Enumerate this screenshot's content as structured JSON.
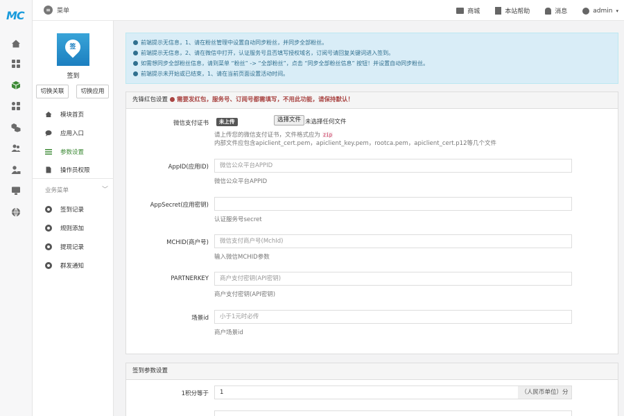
{
  "app": {
    "logo_text": "MC"
  },
  "rail": {
    "icons": [
      "home-icon",
      "grid-icon",
      "cube-icon",
      "apps-icon",
      "cubes-icon",
      "users-icon",
      "user-lock-icon",
      "monitor-icon",
      "globe-icon"
    ],
    "active": "cube-icon",
    "accent": "#3d8a36"
  },
  "topbar": {
    "menu_label": "菜单",
    "shop_label": "商城",
    "help_label": "本站帮助",
    "messages_label": "消息",
    "user_label": "admin"
  },
  "module": {
    "name": "签到",
    "logo_glyph": "签",
    "switch_relation_label": "切换关联",
    "switch_app_label": "切换应用",
    "nav": [
      {
        "label": "模块首页"
      },
      {
        "label": "应用入口"
      },
      {
        "label": "参数设置"
      },
      {
        "label": "操作员权限"
      }
    ],
    "group_title": "业务菜单",
    "group_items": [
      {
        "label": "签到记录"
      },
      {
        "label": "规则添加"
      },
      {
        "label": "提现记录"
      },
      {
        "label": "群发通知"
      }
    ]
  },
  "alert": {
    "lines": [
      "前端提示无信息，1、请在粉丝管理中设置自动同步粉丝，并同步全部粉丝。",
      "前端提示无信息，2、请在微信中打开，认证服务号且否填写授权域名，订阅号请回复关键词进入签到。",
      "如需想同步全部粉丝信息，请到菜单 “粉丝” -> “全部粉丝”，点击 “同步全部粉丝信息” 按钮！并设置自动同步粉丝。",
      "前端提示未开始或已结束，1、请在当前页面设置活动时间。"
    ]
  },
  "redpack_panel": {
    "title": "先锋红包设置",
    "warning": "需要发红包，服务号、订阅号都需填写，不用此功能，请保持默认！",
    "cert": {
      "label": "微信支付证书",
      "badge": "未上传",
      "button": "选择文件",
      "file_status": "未选择任何文件",
      "help_prefix": "请上传您的微信支付证书，文件格式应为",
      "help_code": "zip",
      "help_line2": "内部文件应包含apiclient_cert.pem，apiclient_key.pem，rootca.pem，apiclient_cert.p12等几个文件"
    },
    "fields": [
      {
        "label": "AppID(应用ID)",
        "placeholder": "微信公众平台APPID",
        "value": "",
        "help": "微信公众平台APPID"
      },
      {
        "label": "AppSecret(应用密钥)",
        "placeholder": "",
        "value": "",
        "help": "认证服务号secret"
      },
      {
        "label": "MCHID(商户号)",
        "placeholder": "微信支付商户号(MchId)",
        "value": "",
        "help": "输入微信MCHID参数"
      },
      {
        "label": "PARTNERKEY",
        "placeholder": "商户支付密钥(API密钥)",
        "value": "",
        "help": "商户支付密钥(API密钥)"
      },
      {
        "label": "场景id",
        "placeholder": "小于1元时必传",
        "value": "",
        "help": "商户场景id"
      }
    ]
  },
  "checkin_panel": {
    "title": "签到参数设置",
    "points_label": "1积分等于",
    "points_value": "1",
    "points_addon": "（人民币单位）分"
  }
}
